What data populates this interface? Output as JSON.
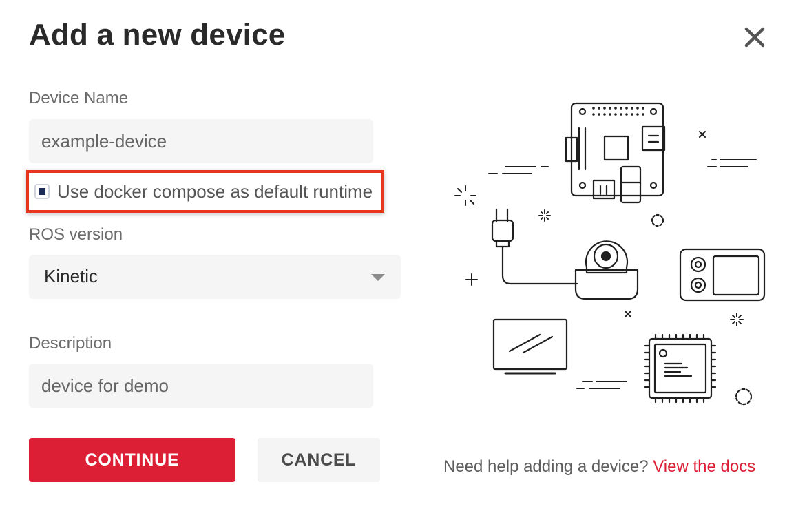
{
  "dialog": {
    "title": "Add a new device",
    "close_icon": "close-icon"
  },
  "form": {
    "device_name": {
      "label": "Device Name",
      "value": "example-device"
    },
    "docker_compose": {
      "label": "Use docker compose as default runtime",
      "checked": true
    },
    "ros_version": {
      "label": "ROS version",
      "selected": "Kinetic"
    },
    "description": {
      "label": "Description",
      "value": "device for demo"
    }
  },
  "buttons": {
    "continue_label": "CONTINUE",
    "cancel_label": "CANCEL"
  },
  "help": {
    "text": "Need help adding a device?",
    "link_text": "View the docs"
  },
  "colors": {
    "primary": "#dc1f35",
    "highlight": "#e8351e",
    "checkbox_fill": "#1c2b5a",
    "input_bg": "#f5f5f5"
  },
  "illustration": {
    "icons": [
      "circuit-board-icon",
      "power-plug-icon",
      "webcam-icon",
      "controller-device-icon",
      "monitor-icon",
      "microchip-icon"
    ]
  }
}
